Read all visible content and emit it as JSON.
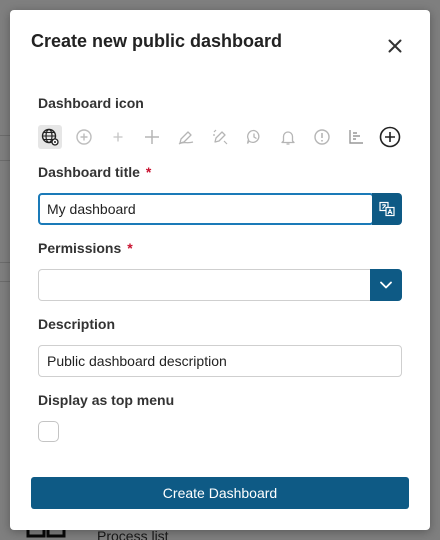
{
  "background": {
    "footer_text": "Process list"
  },
  "modal": {
    "title": "Create new public dashboard",
    "close_icon": "close-icon"
  },
  "icon_field": {
    "label": "Dashboard icon",
    "options": [
      {
        "icon": "globe-network-icon",
        "selected": true
      },
      {
        "icon": "plus-circle-outline-icon"
      },
      {
        "icon": "plus-small-icon"
      },
      {
        "icon": "plus-icon"
      },
      {
        "icon": "pencil-draw-icon"
      },
      {
        "icon": "edit-sparkle-icon"
      },
      {
        "icon": "chat-clock-icon"
      },
      {
        "icon": "bell-icon"
      },
      {
        "icon": "info-circle-icon"
      },
      {
        "icon": "bar-chart-icon"
      },
      {
        "icon": "add-circle-bold-icon"
      }
    ]
  },
  "title_field": {
    "label": "Dashboard title",
    "required_mark": "*",
    "value": "My dashboard",
    "translate_icon": "translate-icon"
  },
  "permissions_field": {
    "label": "Permissions",
    "required_mark": "*",
    "value": "",
    "dropdown_icon": "chevron-down-icon"
  },
  "description_field": {
    "label": "Description",
    "value": "Public dashboard description"
  },
  "top_menu_field": {
    "label": "Display as top menu",
    "checked": false
  },
  "submit": {
    "label": "Create Dashboard"
  },
  "colors": {
    "primary": "#0e5a85",
    "focus": "#1a7ab8",
    "required": "#c8102e"
  }
}
